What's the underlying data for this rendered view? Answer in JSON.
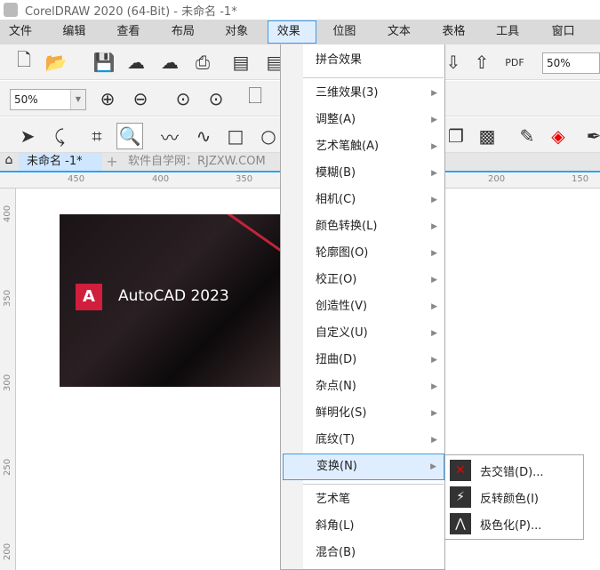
{
  "title": "CorelDRAW 2020 (64-Bit) - 未命名 -1*",
  "menubar": [
    "文件(F)",
    "编辑(E)",
    "查看(V)",
    "布局(L)",
    "对象(J)",
    "效果(C)",
    "位图(B)",
    "文本(X)",
    "表格(T)",
    "工具(O)",
    "窗口(W)"
  ],
  "toolbar": {
    "zoom_left": "50%",
    "zoom_right": "50%",
    "pdf_label": "PDF"
  },
  "tabs": {
    "doc": "未命名 -1*",
    "add": "+",
    "watermark": "软件自学网：RJZXW.COM"
  },
  "ruler_top": [
    "450",
    "400",
    "350",
    "200",
    "150"
  ],
  "ruler_left": [
    "400",
    "350",
    "300",
    "250",
    "200"
  ],
  "image_text": "AutoCAD 2023",
  "effects_menu": {
    "top": "拼合效果",
    "items": [
      "三维效果(3)",
      "调整(A)",
      "艺术笔触(A)",
      "模糊(B)",
      "相机(C)",
      "颜色转换(L)",
      "轮廓图(O)",
      "校正(O)",
      "创造性(V)",
      "自定义(U)",
      "扭曲(D)",
      "杂点(N)",
      "鲜明化(S)",
      "底纹(T)",
      "变换(N)"
    ],
    "bottom": [
      "艺术笔",
      "斜角(L)",
      "混合(B)"
    ]
  },
  "transform_submenu": [
    "去交错(D)...",
    "反转颜色(I)",
    "极色化(P)..."
  ]
}
